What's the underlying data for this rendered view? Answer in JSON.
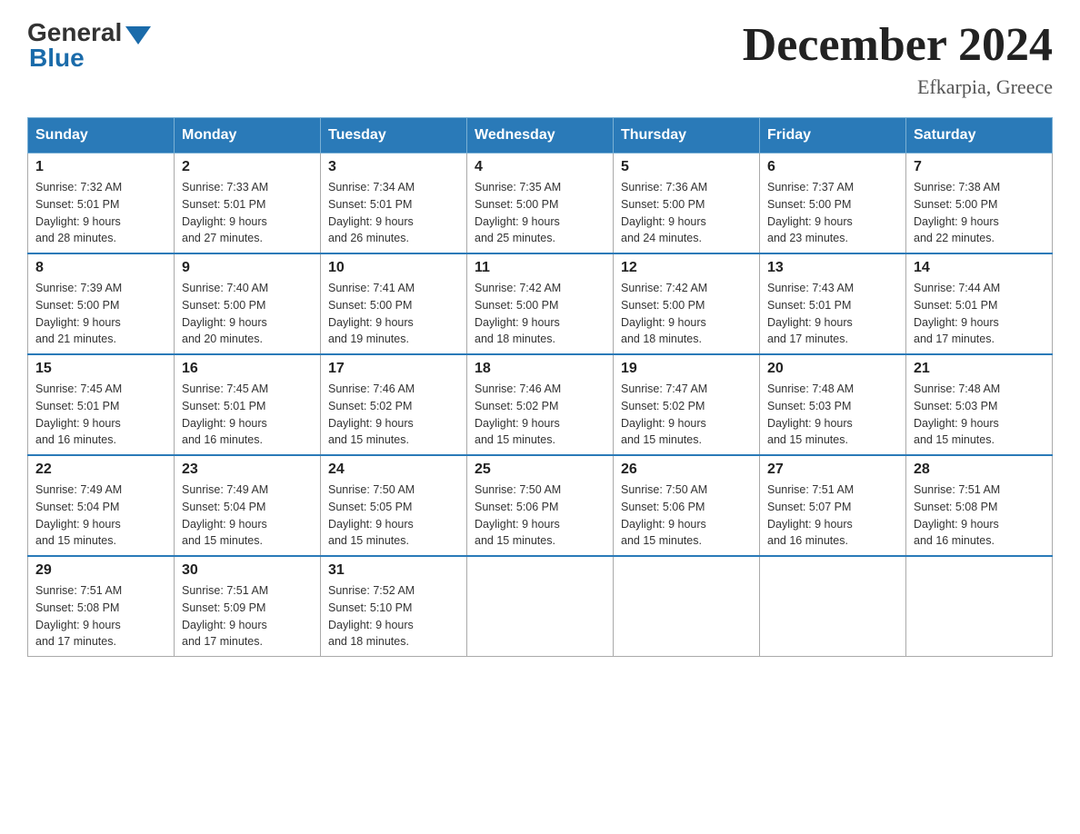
{
  "header": {
    "logo_general": "General",
    "logo_blue": "Blue",
    "month_title": "December 2024",
    "location": "Efkarpia, Greece"
  },
  "days_of_week": [
    "Sunday",
    "Monday",
    "Tuesday",
    "Wednesday",
    "Thursday",
    "Friday",
    "Saturday"
  ],
  "weeks": [
    [
      {
        "day": "1",
        "sunrise": "7:32 AM",
        "sunset": "5:01 PM",
        "daylight": "9 hours and 28 minutes."
      },
      {
        "day": "2",
        "sunrise": "7:33 AM",
        "sunset": "5:01 PM",
        "daylight": "9 hours and 27 minutes."
      },
      {
        "day": "3",
        "sunrise": "7:34 AM",
        "sunset": "5:01 PM",
        "daylight": "9 hours and 26 minutes."
      },
      {
        "day": "4",
        "sunrise": "7:35 AM",
        "sunset": "5:00 PM",
        "daylight": "9 hours and 25 minutes."
      },
      {
        "day": "5",
        "sunrise": "7:36 AM",
        "sunset": "5:00 PM",
        "daylight": "9 hours and 24 minutes."
      },
      {
        "day": "6",
        "sunrise": "7:37 AM",
        "sunset": "5:00 PM",
        "daylight": "9 hours and 23 minutes."
      },
      {
        "day": "7",
        "sunrise": "7:38 AM",
        "sunset": "5:00 PM",
        "daylight": "9 hours and 22 minutes."
      }
    ],
    [
      {
        "day": "8",
        "sunrise": "7:39 AM",
        "sunset": "5:00 PM",
        "daylight": "9 hours and 21 minutes."
      },
      {
        "day": "9",
        "sunrise": "7:40 AM",
        "sunset": "5:00 PM",
        "daylight": "9 hours and 20 minutes."
      },
      {
        "day": "10",
        "sunrise": "7:41 AM",
        "sunset": "5:00 PM",
        "daylight": "9 hours and 19 minutes."
      },
      {
        "day": "11",
        "sunrise": "7:42 AM",
        "sunset": "5:00 PM",
        "daylight": "9 hours and 18 minutes."
      },
      {
        "day": "12",
        "sunrise": "7:42 AM",
        "sunset": "5:00 PM",
        "daylight": "9 hours and 18 minutes."
      },
      {
        "day": "13",
        "sunrise": "7:43 AM",
        "sunset": "5:01 PM",
        "daylight": "9 hours and 17 minutes."
      },
      {
        "day": "14",
        "sunrise": "7:44 AM",
        "sunset": "5:01 PM",
        "daylight": "9 hours and 17 minutes."
      }
    ],
    [
      {
        "day": "15",
        "sunrise": "7:45 AM",
        "sunset": "5:01 PM",
        "daylight": "9 hours and 16 minutes."
      },
      {
        "day": "16",
        "sunrise": "7:45 AM",
        "sunset": "5:01 PM",
        "daylight": "9 hours and 16 minutes."
      },
      {
        "day": "17",
        "sunrise": "7:46 AM",
        "sunset": "5:02 PM",
        "daylight": "9 hours and 15 minutes."
      },
      {
        "day": "18",
        "sunrise": "7:46 AM",
        "sunset": "5:02 PM",
        "daylight": "9 hours and 15 minutes."
      },
      {
        "day": "19",
        "sunrise": "7:47 AM",
        "sunset": "5:02 PM",
        "daylight": "9 hours and 15 minutes."
      },
      {
        "day": "20",
        "sunrise": "7:48 AM",
        "sunset": "5:03 PM",
        "daylight": "9 hours and 15 minutes."
      },
      {
        "day": "21",
        "sunrise": "7:48 AM",
        "sunset": "5:03 PM",
        "daylight": "9 hours and 15 minutes."
      }
    ],
    [
      {
        "day": "22",
        "sunrise": "7:49 AM",
        "sunset": "5:04 PM",
        "daylight": "9 hours and 15 minutes."
      },
      {
        "day": "23",
        "sunrise": "7:49 AM",
        "sunset": "5:04 PM",
        "daylight": "9 hours and 15 minutes."
      },
      {
        "day": "24",
        "sunrise": "7:50 AM",
        "sunset": "5:05 PM",
        "daylight": "9 hours and 15 minutes."
      },
      {
        "day": "25",
        "sunrise": "7:50 AM",
        "sunset": "5:06 PM",
        "daylight": "9 hours and 15 minutes."
      },
      {
        "day": "26",
        "sunrise": "7:50 AM",
        "sunset": "5:06 PM",
        "daylight": "9 hours and 15 minutes."
      },
      {
        "day": "27",
        "sunrise": "7:51 AM",
        "sunset": "5:07 PM",
        "daylight": "9 hours and 16 minutes."
      },
      {
        "day": "28",
        "sunrise": "7:51 AM",
        "sunset": "5:08 PM",
        "daylight": "9 hours and 16 minutes."
      }
    ],
    [
      {
        "day": "29",
        "sunrise": "7:51 AM",
        "sunset": "5:08 PM",
        "daylight": "9 hours and 17 minutes."
      },
      {
        "day": "30",
        "sunrise": "7:51 AM",
        "sunset": "5:09 PM",
        "daylight": "9 hours and 17 minutes."
      },
      {
        "day": "31",
        "sunrise": "7:52 AM",
        "sunset": "5:10 PM",
        "daylight": "9 hours and 18 minutes."
      },
      null,
      null,
      null,
      null
    ]
  ],
  "labels": {
    "sunrise": "Sunrise:",
    "sunset": "Sunset:",
    "daylight": "Daylight:"
  }
}
